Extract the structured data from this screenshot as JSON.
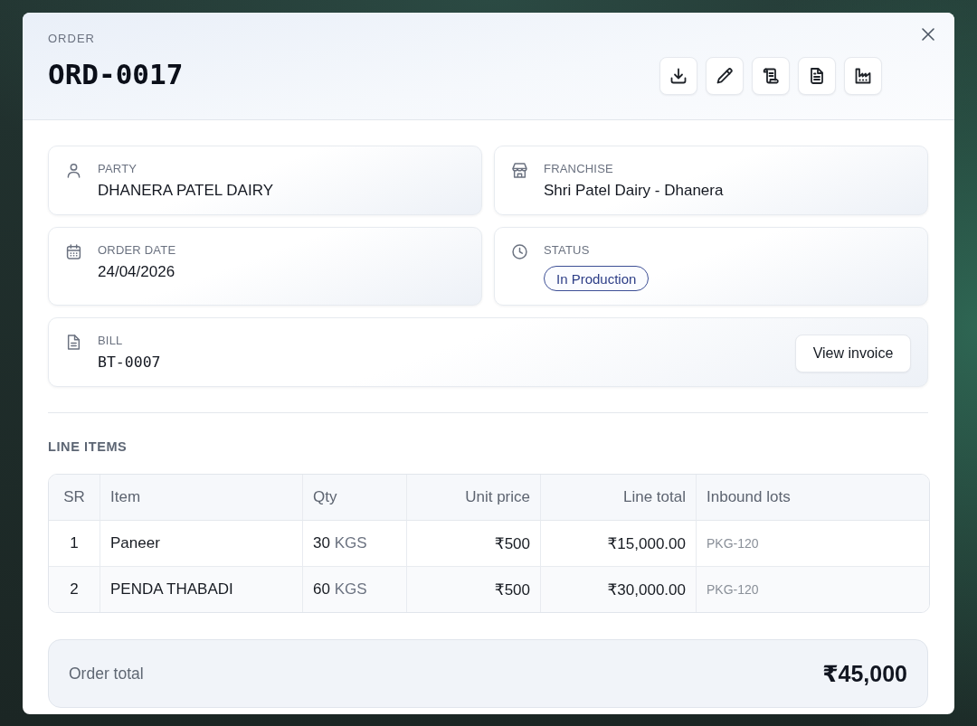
{
  "header": {
    "eyebrow": "ORDER",
    "title": "ORD-0017"
  },
  "details": [
    {
      "kind": "party",
      "label": "PARTY",
      "value": "DHANERA PATEL DAIRY"
    },
    {
      "kind": "franchise",
      "label": "FRANCHISE",
      "value": "Shri Patel Dairy - Dhanera"
    },
    {
      "kind": "date",
      "label": "ORDER DATE",
      "value": "24/04/2026"
    },
    {
      "kind": "status",
      "label": "STATUS",
      "badge": "In Production"
    },
    {
      "kind": "bill",
      "label": "BILL",
      "value": "BT-0007",
      "button": "View invoice"
    }
  ],
  "line_items": {
    "title": "LINE ITEMS",
    "columns": [
      "SR",
      "Item",
      "Qty",
      "Unit price",
      "Line total",
      "Inbound lots"
    ],
    "rows": [
      {
        "sr": "1",
        "item": "Paneer",
        "qty": "30",
        "unit": "KGS",
        "unit_price": "₹500",
        "line_total": "₹15,000.00",
        "inbound_lots": "PKG-120"
      },
      {
        "sr": "2",
        "item": "PENDA THABADI",
        "qty": "60",
        "unit": "KGS",
        "unit_price": "₹500",
        "line_total": "₹30,000.00",
        "inbound_lots": "PKG-120"
      }
    ]
  },
  "order_total": {
    "label": "Order total",
    "value": "₹45,000"
  }
}
